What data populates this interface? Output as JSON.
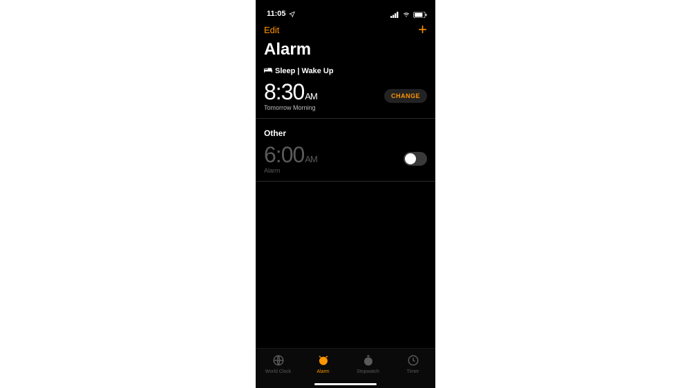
{
  "statusbar": {
    "time": "11:05"
  },
  "nav": {
    "edit_label": "Edit"
  },
  "title": "Alarm",
  "sleep": {
    "header_label": "Sleep | Wake Up",
    "time": "8:30",
    "period": "AM",
    "subtext": "Tomorrow Morning",
    "change_label": "CHANGE"
  },
  "other": {
    "header_label": "Other",
    "alarms": [
      {
        "time": "6:00",
        "period": "AM",
        "label": "Alarm",
        "enabled": false
      }
    ]
  },
  "tabs": {
    "world_clock": "World Clock",
    "alarm": "Alarm",
    "stopwatch": "Stopwatch",
    "timer": "Timer"
  },
  "colors": {
    "accent": "#ff9500"
  }
}
